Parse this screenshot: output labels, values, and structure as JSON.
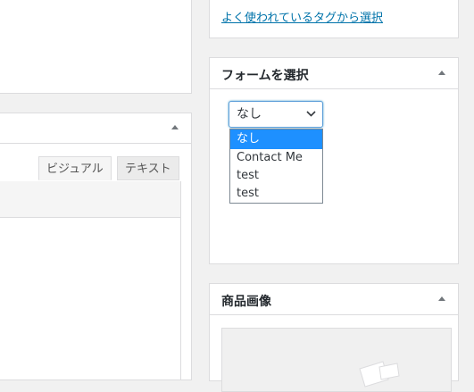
{
  "tags": {
    "link_label": "よく使われているタグから選択"
  },
  "editor": {
    "tab_visual": "ビジュアル",
    "tab_text": "テキスト"
  },
  "form_box": {
    "title": "フォームを選択",
    "selected": "なし",
    "options": [
      "なし",
      "Contact Me",
      "test",
      "test"
    ]
  },
  "image_box": {
    "title": "商品画像"
  },
  "icons": {
    "toggle": "triangle-up-icon",
    "chevron": "chevron-down-icon"
  }
}
